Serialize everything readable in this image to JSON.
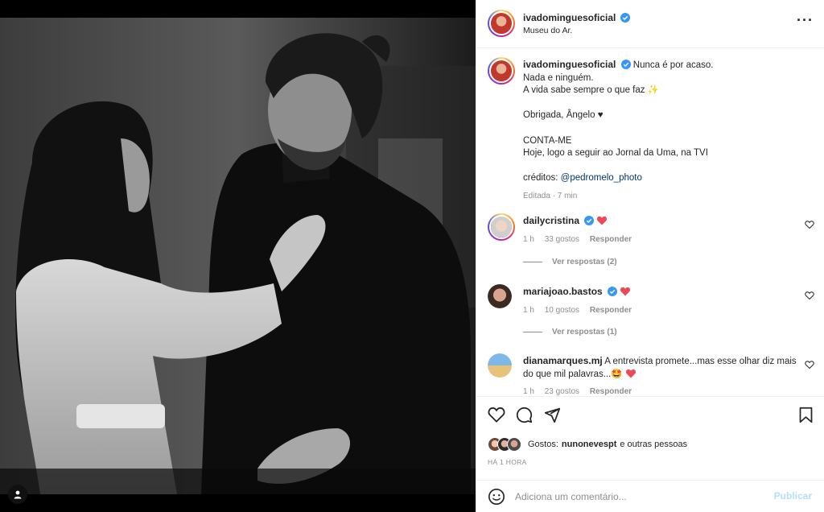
{
  "post": {
    "author": "ivadominguesoficial",
    "location": "Museu do Ar.",
    "caption_lines": [
      "Nunca é por acaso.",
      "Nada e ninguém.",
      "A vida sabe sempre o que faz ✨",
      "",
      "Obrigada, Ângelo ♥",
      "",
      "CONTA-ME",
      "Hoje, logo a seguir ao Jornal da Uma, na TVI",
      ""
    ],
    "credits_label": "créditos:",
    "credits_handle": "@pedromelo_photo",
    "edited": "Editada · 7 min"
  },
  "comments": [
    {
      "user": "dailycristina",
      "verified": true,
      "text": "",
      "time": "1 h",
      "likes": "33 gostos",
      "reply": "Responder",
      "view_replies": "Ver respostas (2)"
    },
    {
      "user": "mariajoao.bastos",
      "verified": true,
      "text": "",
      "time": "1 h",
      "likes": "10 gostos",
      "reply": "Responder",
      "view_replies": "Ver respostas (1)"
    },
    {
      "user": "dianamarques.mj",
      "verified": false,
      "text": "A entrevista promete...mas esse olhar diz mais do que mil palavras...🤩",
      "time": "1 h",
      "likes": "23 gostos",
      "reply": "Responder"
    }
  ],
  "likes": {
    "label": "Gostos:",
    "first_user": "nunonevespt",
    "rest": "e outras pessoas"
  },
  "timestamp": "HÁ 1 HORA",
  "comment_box": {
    "placeholder": "Adiciona um comentário...",
    "publish": "Publicar"
  },
  "colors": {
    "verified": "#3897f0",
    "heart": "#ed4956",
    "link": "#00376b",
    "publish_disabled": "#b2dffc"
  },
  "icons": [
    "more-options-icon",
    "heart-icon",
    "comment-icon",
    "share-icon",
    "bookmark-icon",
    "emoji-icon",
    "user-tag-icon"
  ]
}
